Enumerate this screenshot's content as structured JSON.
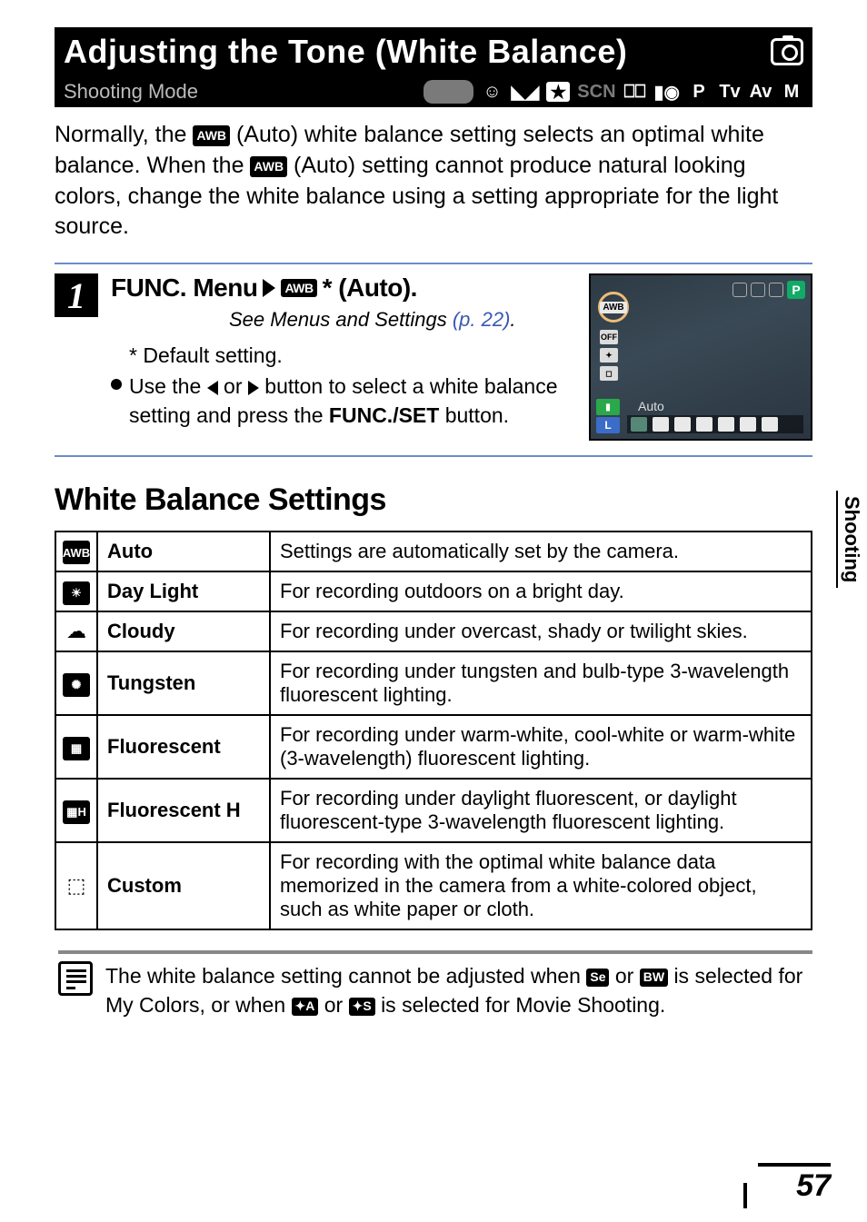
{
  "title_bar": {
    "heading": "Adjusting the Tone (White Balance)"
  },
  "mode_bar": {
    "label": "Shooting Mode",
    "auto": "AUTO",
    "scn": "SCN",
    "p": "P",
    "tv": "Tv",
    "av": "Av",
    "m": "M"
  },
  "intro": {
    "part1": "Normally, the ",
    "awb1": "AWB",
    "part2": " (Auto) white balance setting selects an optimal white balance. When the ",
    "awb2": "AWB",
    "part3": " (Auto) setting cannot produce natural looking colors, change the white balance using a setting appropriate for the light source."
  },
  "step": {
    "number": "1",
    "title_prefix": "FUNC. Menu",
    "title_suffix": "* (Auto).",
    "awb": "AWB",
    "see_text": "See Menus and Settings ",
    "see_link": "(p. 22)",
    "see_dot": ".",
    "default": "* Default setting.",
    "bullet_part1": "Use the ",
    "bullet_part2": " or ",
    "bullet_part3": " button to select a white balance setting and press the ",
    "func_set": "FUNC./SET",
    "bullet_part4": " button."
  },
  "screenshot": {
    "awb": "AWB",
    "off": "OFF",
    "auto": "Auto",
    "p": "P",
    "l": "L"
  },
  "section_heading": "White Balance Settings",
  "table": [
    {
      "glyph": "AWB",
      "style": "box",
      "name": "Auto",
      "desc": "Settings are automatically set by the camera."
    },
    {
      "glyph": "☀",
      "style": "box",
      "name": "Day Light",
      "desc": "For recording outdoors on a bright day."
    },
    {
      "glyph": "☁",
      "style": "plain",
      "name": "Cloudy",
      "desc": "For recording under overcast, shady or twilight skies."
    },
    {
      "glyph": "✺",
      "style": "box",
      "name": "Tungsten",
      "desc": "For recording under tungsten and bulb-type 3-wavelength fluorescent lighting."
    },
    {
      "glyph": "▦",
      "style": "box",
      "name": "Fluorescent",
      "desc": "For recording under warm-white, cool-white or warm-white (3-wavelength) fluorescent lighting."
    },
    {
      "glyph": "▦H",
      "style": "box",
      "name": "Fluorescent H",
      "desc": "For recording under daylight fluorescent, or daylight fluorescent-type 3-wavelength fluorescent lighting."
    },
    {
      "glyph": "⬚",
      "style": "plain",
      "name": "Custom",
      "desc": "For recording with the optimal white balance data memorized in the camera from a white-colored object, such as white paper or cloth."
    }
  ],
  "note": {
    "p1": "The white balance setting cannot be adjusted when ",
    "b1": "Se",
    "p2": " or ",
    "b2": "BW",
    "p3": " is selected for My Colors, or when ",
    "b3": "✦A",
    "p4": " or ",
    "b4": "✦S",
    "p5": " is selected for Movie Shooting."
  },
  "side_tab": "Shooting",
  "page_number": "57"
}
